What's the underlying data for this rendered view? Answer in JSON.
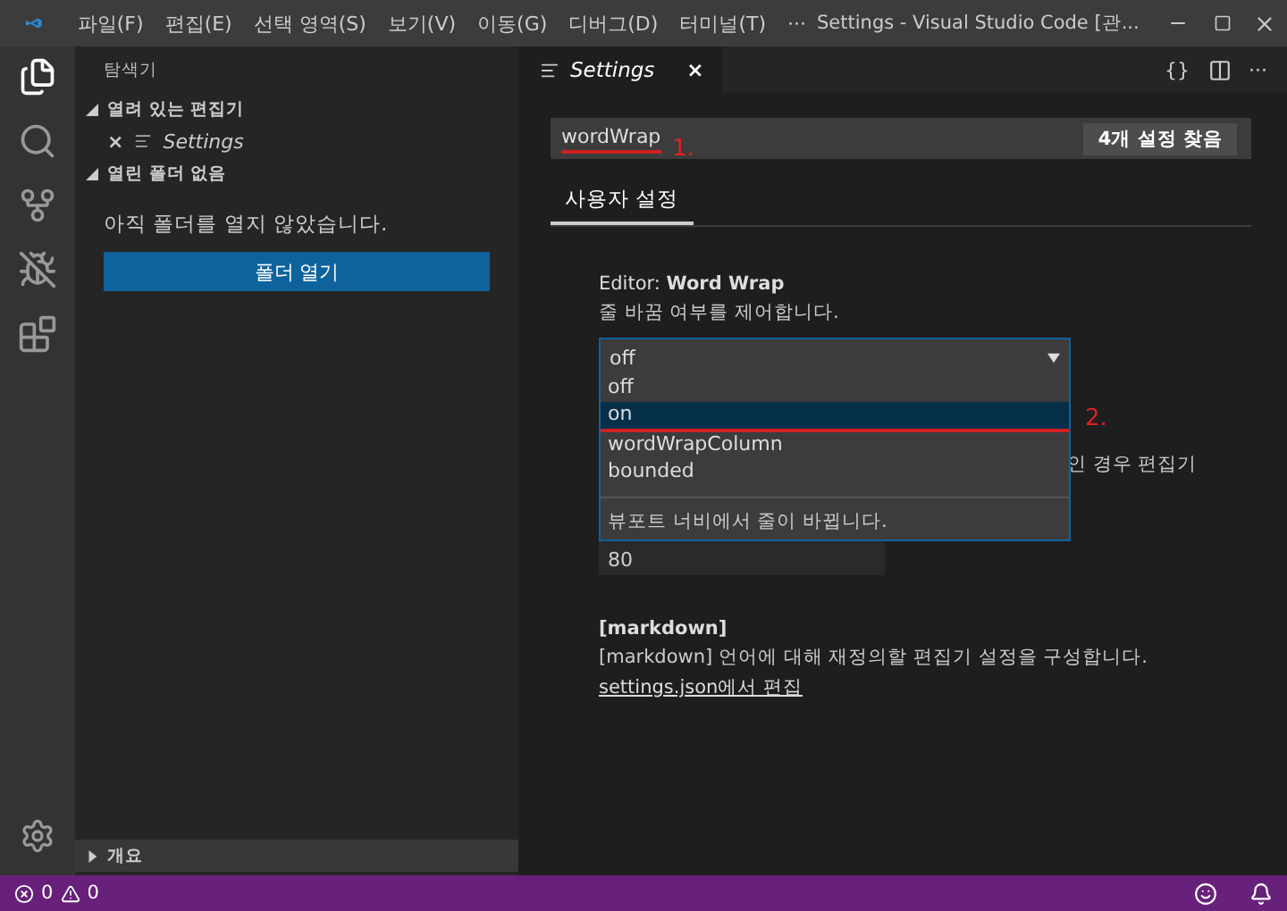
{
  "title_bar": {
    "menus": [
      "파일(F)",
      "편집(E)",
      "선택 영역(S)",
      "보기(V)",
      "이동(G)",
      "디버그(D)",
      "터미널(T)",
      "···"
    ],
    "title": "Settings - Visual Studio Code [관..."
  },
  "sidebar": {
    "header": "탐색기",
    "sections": [
      {
        "title": "열려 있는 편집기",
        "expanded": true,
        "items": [
          {
            "label": "Settings",
            "close": "×"
          }
        ]
      },
      {
        "title": "열린 폴더 없음",
        "expanded": true,
        "message": "아직 폴더를 열지 않았습니다.",
        "button": "폴더 열기"
      }
    ],
    "bottom_section": {
      "title": "개요",
      "expanded": false
    }
  },
  "editor": {
    "tabs": [
      {
        "label": "Settings",
        "close": "×",
        "selected": true
      }
    ],
    "actions": [
      "{}",
      "···"
    ],
    "search": {
      "value": "wordWrap",
      "result_badge": "4개 설정 찾음",
      "annotation": "1."
    },
    "scope_tabs": [
      {
        "label": "사용자 설정",
        "selected": true
      }
    ],
    "settings": [
      {
        "kind": "dropdown",
        "label": "Editor: **Word Wrap**",
        "description": "줄 바꿈 여부를 제어합니다.",
        "value": "off",
        "options": [
          {
            "label": "off",
            "highlighted": false
          },
          {
            "label": "on",
            "highlighted": true
          },
          {
            "label": "wordWrapColumn",
            "highlighted": false
          },
          {
            "label": "bounded",
            "highlighted": false
          }
        ],
        "option_description": "뷰포트 너비에서 줄이 바뀝니다.",
        "annotation": "2."
      },
      {
        "kind": "number",
        "description": "인 경우 편집기",
        "value": "80"
      },
      {
        "kind": "section",
        "label": "[markdown]",
        "description": "[markdown] 언어에 대해 재정의할 편집기 설정을 구성합니다.",
        "link": "settings.json에서 편집"
      }
    ]
  },
  "status_bar": {
    "errors": "0",
    "warnings": "0"
  }
}
